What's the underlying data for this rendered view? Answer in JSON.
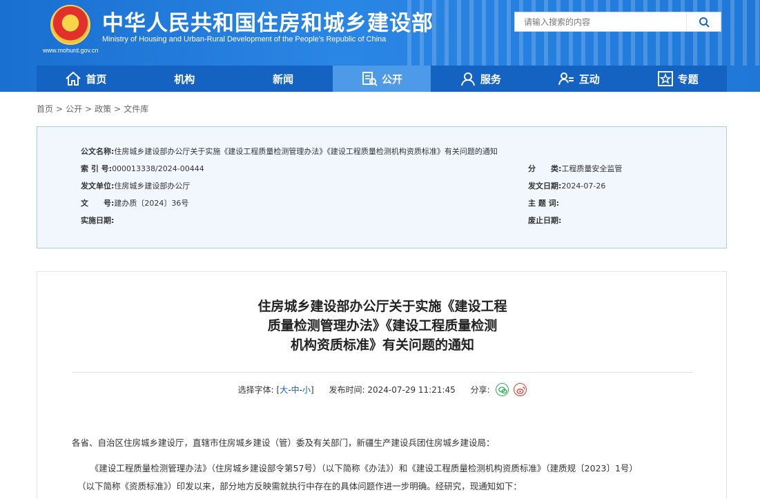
{
  "header": {
    "title_cn": "中华人民共和国住房和城乡建设部",
    "title_en": "Ministry of Housing and Urban-Rural Development of the People’s Republic of China",
    "domain": "www.mohurd.gov.cn",
    "search_placeholder": "请输入搜索的内容"
  },
  "nav": [
    {
      "label": "首页",
      "icon": "home-icon"
    },
    {
      "label": "机构",
      "icon": ""
    },
    {
      "label": "新闻",
      "icon": ""
    },
    {
      "label": "公开",
      "icon": "document-icon",
      "active": true
    },
    {
      "label": "服务",
      "icon": "service-icon"
    },
    {
      "label": "互动",
      "icon": "interact-icon"
    },
    {
      "label": "专题",
      "icon": "star-icon"
    }
  ],
  "breadcrumb": [
    "首页",
    "公开",
    "政策",
    "文件库"
  ],
  "meta": {
    "doc_name_label": "公文名称:",
    "doc_name": "住房城乡建设部办公厅关于实施《建设工程质量检测管理办法》《建设工程质量检测机构资质标准》有关问题的通知",
    "index_label": "索 引 号:",
    "index": "000013338/2024-00444",
    "category_label": "分　　类:",
    "category": "工程质量安全监管",
    "issuer_label": "发文单位:",
    "issuer": "住房城乡建设部办公厅",
    "issue_date_label": "发文日期:",
    "issue_date": "2024-07-26",
    "doc_no_label": "文　　号:",
    "doc_no": "建办质〔2024〕36号",
    "keywords_label": "主 题 词:",
    "keywords": "",
    "effective_label": "实施日期:",
    "effective": "",
    "repeal_label": "废止日期:",
    "repeal": ""
  },
  "article": {
    "title_lines": [
      "住房城乡建设部办公厅关于实施《建设工程",
      "质量检测管理办法》《建设工程质量检测",
      "机构资质标准》有关问题的通知"
    ],
    "font_label": "选择字体:",
    "font_open": "[",
    "font_large": "大",
    "font_dash1": "-",
    "font_medium": "中",
    "font_dash2": "-",
    "font_small": "小",
    "font_close": "]",
    "publish_label": "发布时间:",
    "publish_time": "2024-07-29 11:21:45",
    "share_label": "分享:",
    "para1": "各省、自治区住房城乡建设厅，直辖市住房城乡建设（管）委及有关部门，新疆生产建设兵团住房城乡建设局：",
    "para2_line1": "　　《建设工程质量检测管理办法》（住房城乡建设部令第57号）（以下简称《办法》）和《建设工程质量检测机构资质标准》（建质规〔2023〕1号）",
    "para2_line2": "（以下简称《资质标准》）印发以来，部分地方反映需就执行中存在的具体问题作进一步明确。经研究，现通知如下："
  },
  "colors": {
    "header_blue": "#1f78d8",
    "nav_blue": "#1463c2",
    "nav_active": "#4d9ae8",
    "meta_bg": "#f1f7fc",
    "link_blue": "#1a5fb4",
    "wechat_green": "#2aae4b",
    "weibo_red": "#e2362a"
  }
}
